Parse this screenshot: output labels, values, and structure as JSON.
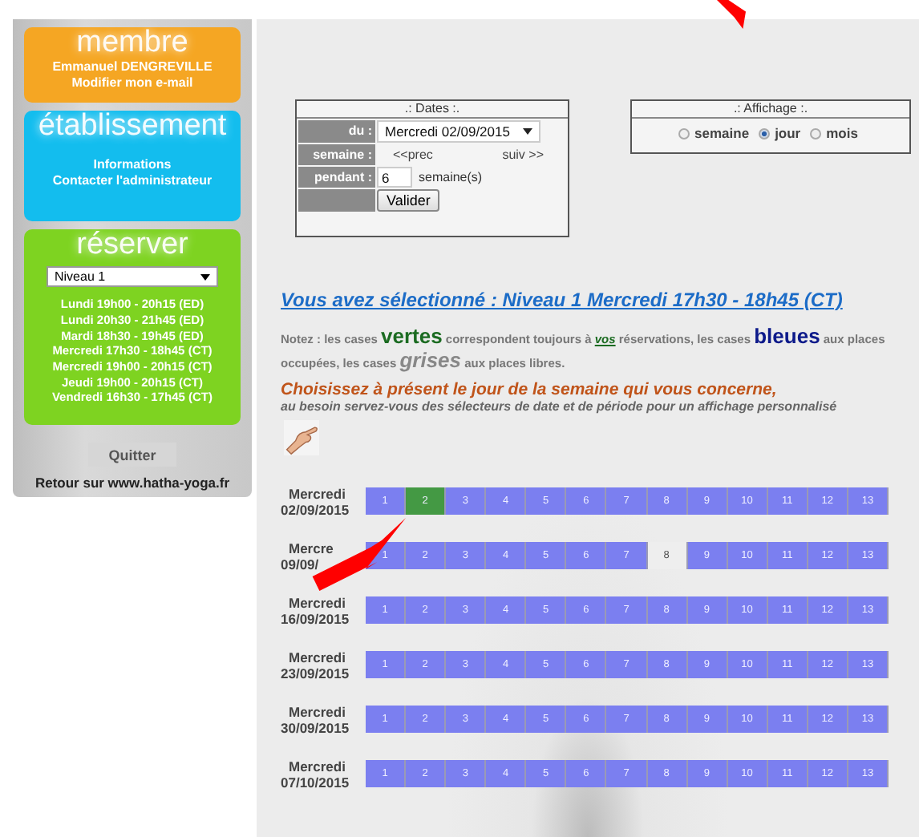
{
  "sidebar": {
    "membre": {
      "title": "membre",
      "lines": [
        "Emmanuel DENGREVILLE",
        "Modifier mon e-mail"
      ]
    },
    "etablissement": {
      "title": "établissement",
      "lines": [
        "Informations",
        "Contacter l'administrateur"
      ]
    },
    "reserver": {
      "title": "réserver",
      "select": "Niveau 1",
      "sessions": [
        "Lundi 19h00 - 20h15 (ED)",
        "Lundi 20h30 - 21h45 (ED)",
        "Mardi 18h30 - 19h45 (ED)",
        "Mercredi 17h30 - 18h45 (CT)",
        "Mercredi 19h00 - 20h15 (CT)",
        "Jeudi 19h00 - 20h15 (CT)",
        "Vendredi 16h30 - 17h45 (CT)"
      ]
    },
    "quit_button": "Quitter",
    "back_link": "Retour sur www.hatha-yoga.fr"
  },
  "dates": {
    "title": ".: Dates :.",
    "du_label": "du :",
    "du_value": "Mercredi 02/09/2015",
    "semaine_label": "semaine :",
    "prev": "<<prec",
    "next": "suiv >>",
    "pendant_label": "pendant :",
    "pendant_value": "6",
    "pendant_unit": "semaine(s)",
    "submit": "Valider"
  },
  "affichage": {
    "title": ".: Affichage :.",
    "options": [
      {
        "label": "semaine",
        "selected": false
      },
      {
        "label": "jour",
        "selected": true
      },
      {
        "label": "mois",
        "selected": false
      }
    ]
  },
  "selection": "Vous avez sélectionné : Niveau 1 Mercredi 17h30 - 18h45 (CT)",
  "note": [
    {
      "kind": "plain",
      "text": "Notez : les cases "
    },
    {
      "kind": "green",
      "text": "vertes"
    },
    {
      "kind": "plain",
      "text": " correspondent toujours à "
    },
    {
      "kind": "link",
      "text": "vos"
    },
    {
      "kind": "plain",
      "text": " réservations, les cases "
    },
    {
      "kind": "blue",
      "text": "bleues"
    },
    {
      "kind": "plain",
      "text": " aux places occupées, les cases "
    },
    {
      "kind": "grey",
      "text": "grises"
    },
    {
      "kind": "plain",
      "text": " aux places libres."
    }
  ],
  "instruction": "Choisissez à présent le jour de la semaine qui vous concerne,",
  "instruction_sub": "au besoin servez-vous des sélecteurs de date et de période pour un affichage personnalisé",
  "days": [
    {
      "day": "Mercredi",
      "date": "02/09/2015",
      "cells": [
        {
          "label": "1",
          "color": "#7b7ff0"
        },
        {
          "label": "2",
          "color": "#449944"
        },
        {
          "label": "3",
          "color": "#7b7ff0"
        },
        {
          "label": "4",
          "color": "#7b7ff0"
        },
        {
          "label": "5",
          "color": "#7b7ff0"
        },
        {
          "label": "6",
          "color": "#7b7ff0"
        },
        {
          "label": "7",
          "color": "#7b7ff0"
        },
        {
          "label": "8",
          "color": "#7b7ff0"
        },
        {
          "label": "9",
          "color": "#7b7ff0"
        },
        {
          "label": "10",
          "color": "#7b7ff0"
        },
        {
          "label": "11",
          "color": "#7b7ff0"
        },
        {
          "label": "12",
          "color": "#7b7ff0"
        },
        {
          "label": "13",
          "color": "#7b7ff0"
        }
      ]
    },
    {
      "day": "Mercre",
      "date": "09/09/",
      "cells": [
        {
          "label": "1",
          "color": "#7b7ff0"
        },
        {
          "label": "2",
          "color": "#7b7ff0"
        },
        {
          "label": "3",
          "color": "#7b7ff0"
        },
        {
          "label": "4",
          "color": "#7b7ff0"
        },
        {
          "label": "5",
          "color": "#7b7ff0"
        },
        {
          "label": "6",
          "color": "#7b7ff0"
        },
        {
          "label": "7",
          "color": "#7b7ff0"
        },
        {
          "label": "8",
          "color": "#eeeeee"
        },
        {
          "label": "9",
          "color": "#7b7ff0"
        },
        {
          "label": "10",
          "color": "#7b7ff0"
        },
        {
          "label": "11",
          "color": "#7b7ff0"
        },
        {
          "label": "12",
          "color": "#7b7ff0"
        },
        {
          "label": "13",
          "color": "#7b7ff0"
        }
      ]
    },
    {
      "day": "Mercredi",
      "date": "16/09/2015",
      "cells": [
        {
          "label": "1",
          "color": "#7b7ff0"
        },
        {
          "label": "2",
          "color": "#7b7ff0"
        },
        {
          "label": "3",
          "color": "#7b7ff0"
        },
        {
          "label": "4",
          "color": "#7b7ff0"
        },
        {
          "label": "5",
          "color": "#7b7ff0"
        },
        {
          "label": "6",
          "color": "#7b7ff0"
        },
        {
          "label": "7",
          "color": "#7b7ff0"
        },
        {
          "label": "8",
          "color": "#7b7ff0"
        },
        {
          "label": "9",
          "color": "#7b7ff0"
        },
        {
          "label": "10",
          "color": "#7b7ff0"
        },
        {
          "label": "11",
          "color": "#7b7ff0"
        },
        {
          "label": "12",
          "color": "#7b7ff0"
        },
        {
          "label": "13",
          "color": "#7b7ff0"
        }
      ]
    },
    {
      "day": "Mercredi",
      "date": "23/09/2015",
      "cells": [
        {
          "label": "1",
          "color": "#7b7ff0"
        },
        {
          "label": "2",
          "color": "#7b7ff0"
        },
        {
          "label": "3",
          "color": "#7b7ff0"
        },
        {
          "label": "4",
          "color": "#7b7ff0"
        },
        {
          "label": "5",
          "color": "#7b7ff0"
        },
        {
          "label": "6",
          "color": "#7b7ff0"
        },
        {
          "label": "7",
          "color": "#7b7ff0"
        },
        {
          "label": "8",
          "color": "#7b7ff0"
        },
        {
          "label": "9",
          "color": "#7b7ff0"
        },
        {
          "label": "10",
          "color": "#7b7ff0"
        },
        {
          "label": "11",
          "color": "#7b7ff0"
        },
        {
          "label": "12",
          "color": "#7b7ff0"
        },
        {
          "label": "13",
          "color": "#7b7ff0"
        }
      ]
    },
    {
      "day": "Mercredi",
      "date": "30/09/2015",
      "cells": [
        {
          "label": "1",
          "color": "#7b7ff0"
        },
        {
          "label": "2",
          "color": "#7b7ff0"
        },
        {
          "label": "3",
          "color": "#7b7ff0"
        },
        {
          "label": "4",
          "color": "#7b7ff0"
        },
        {
          "label": "5",
          "color": "#7b7ff0"
        },
        {
          "label": "6",
          "color": "#7b7ff0"
        },
        {
          "label": "7",
          "color": "#7b7ff0"
        },
        {
          "label": "8",
          "color": "#7b7ff0"
        },
        {
          "label": "9",
          "color": "#7b7ff0"
        },
        {
          "label": "10",
          "color": "#7b7ff0"
        },
        {
          "label": "11",
          "color": "#7b7ff0"
        },
        {
          "label": "12",
          "color": "#7b7ff0"
        },
        {
          "label": "13",
          "color": "#7b7ff0"
        }
      ]
    },
    {
      "day": "Mercredi",
      "date": "07/10/2015",
      "cells": [
        {
          "label": "1",
          "color": "#7b7ff0"
        },
        {
          "label": "2",
          "color": "#7b7ff0"
        },
        {
          "label": "3",
          "color": "#7b7ff0"
        },
        {
          "label": "4",
          "color": "#7b7ff0"
        },
        {
          "label": "5",
          "color": "#7b7ff0"
        },
        {
          "label": "6",
          "color": "#7b7ff0"
        },
        {
          "label": "7",
          "color": "#7b7ff0"
        },
        {
          "label": "8",
          "color": "#7b7ff0"
        },
        {
          "label": "9",
          "color": "#7b7ff0"
        },
        {
          "label": "10",
          "color": "#7b7ff0"
        },
        {
          "label": "11",
          "color": "#7b7ff0"
        },
        {
          "label": "12",
          "color": "#7b7ff0"
        },
        {
          "label": "13",
          "color": "#7b7ff0"
        }
      ]
    }
  ]
}
